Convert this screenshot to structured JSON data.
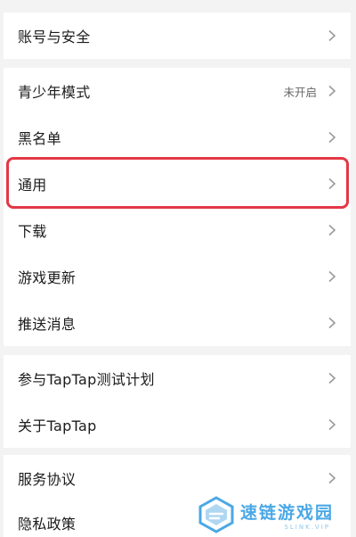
{
  "settings": {
    "groups": [
      {
        "items": [
          {
            "label": "账号与安全",
            "value": ""
          }
        ]
      },
      {
        "items": [
          {
            "label": "青少年模式",
            "value": "未开启"
          },
          {
            "label": "黑名单",
            "value": ""
          },
          {
            "label": "通用",
            "value": ""
          },
          {
            "label": "下载",
            "value": ""
          },
          {
            "label": "游戏更新",
            "value": ""
          },
          {
            "label": "推送消息",
            "value": ""
          }
        ]
      },
      {
        "items": [
          {
            "label": "参与TapTap测试计划",
            "value": ""
          },
          {
            "label": "关于TapTap",
            "value": ""
          }
        ]
      },
      {
        "items": [
          {
            "label": "服务协议",
            "value": ""
          },
          {
            "label": "隐私政策",
            "value": ""
          }
        ]
      }
    ]
  },
  "highlighted_item": "通用",
  "watermark": {
    "text": "速链游戏园",
    "subtext": "SLINK.VIP"
  },
  "colors": {
    "background": "#f3f3f3",
    "row_background": "#ffffff",
    "highlight_border": "#e33845",
    "chevron": "#9a9a9a",
    "watermark": "#4aa8e6"
  },
  "icons": {
    "row_arrow": "chevron-right-icon",
    "watermark_logo": "watermark-logo-icon"
  }
}
